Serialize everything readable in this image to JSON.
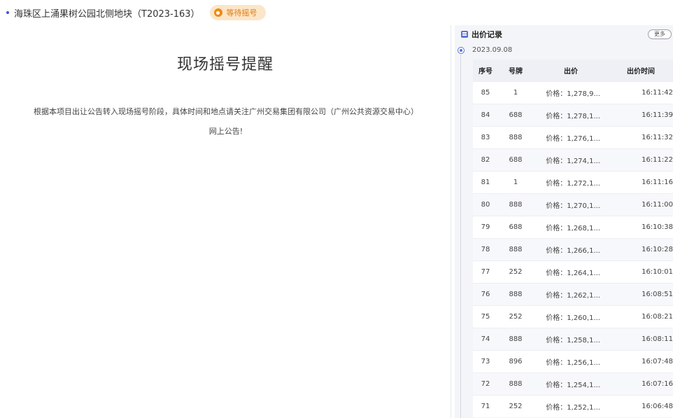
{
  "header": {
    "title": "海珠区上涌果树公园北侧地块（T2023-163）",
    "status_badge": "等待摇号"
  },
  "notice": {
    "title": "现场摇号提醒",
    "body_line1": "根据本项目出让公告转入现场摇号阶段，具体时间和地点请关注广州交易集团有限公司（广州公共资源交易中心）",
    "body_line2": "网上公告!"
  },
  "bid_panel": {
    "title": "出价记录",
    "more_label": "更多",
    "date": "2023.09.08",
    "columns": [
      "序号",
      "号牌",
      "出价",
      "出价时间"
    ],
    "rows": [
      {
        "seq": "85",
        "plate": "1",
        "price": "价格：1,278,9...",
        "time": "16:11:42"
      },
      {
        "seq": "84",
        "plate": "688",
        "price": "价格：1,278,1...",
        "time": "16:11:39"
      },
      {
        "seq": "83",
        "plate": "888",
        "price": "价格：1,276,1...",
        "time": "16:11:32"
      },
      {
        "seq": "82",
        "plate": "688",
        "price": "价格：1,274,1...",
        "time": "16:11:22"
      },
      {
        "seq": "81",
        "plate": "1",
        "price": "价格：1,272,1...",
        "time": "16:11:16"
      },
      {
        "seq": "80",
        "plate": "888",
        "price": "价格：1,270,1...",
        "time": "16:11:00"
      },
      {
        "seq": "79",
        "plate": "688",
        "price": "价格：1,268,1...",
        "time": "16:10:38"
      },
      {
        "seq": "78",
        "plate": "888",
        "price": "价格：1,266,1...",
        "time": "16:10:28"
      },
      {
        "seq": "77",
        "plate": "252",
        "price": "价格：1,264,1...",
        "time": "16:10:01"
      },
      {
        "seq": "76",
        "plate": "888",
        "price": "价格：1,262,1...",
        "time": "16:08:51"
      },
      {
        "seq": "75",
        "plate": "252",
        "price": "价格：1,260,1...",
        "time": "16:08:21"
      },
      {
        "seq": "74",
        "plate": "888",
        "price": "价格：1,258,1...",
        "time": "16:08:11"
      },
      {
        "seq": "73",
        "plate": "896",
        "price": "价格：1,256,1...",
        "time": "16:07:48"
      },
      {
        "seq": "72",
        "plate": "888",
        "price": "价格：1,254,1...",
        "time": "16:07:16"
      },
      {
        "seq": "71",
        "plate": "252",
        "price": "价格：1,252,1...",
        "time": "16:06:48"
      }
    ]
  },
  "colors": {
    "badge_bg": "#fbe6c8",
    "badge_text": "#e07a12",
    "accent": "#5b74d6"
  }
}
